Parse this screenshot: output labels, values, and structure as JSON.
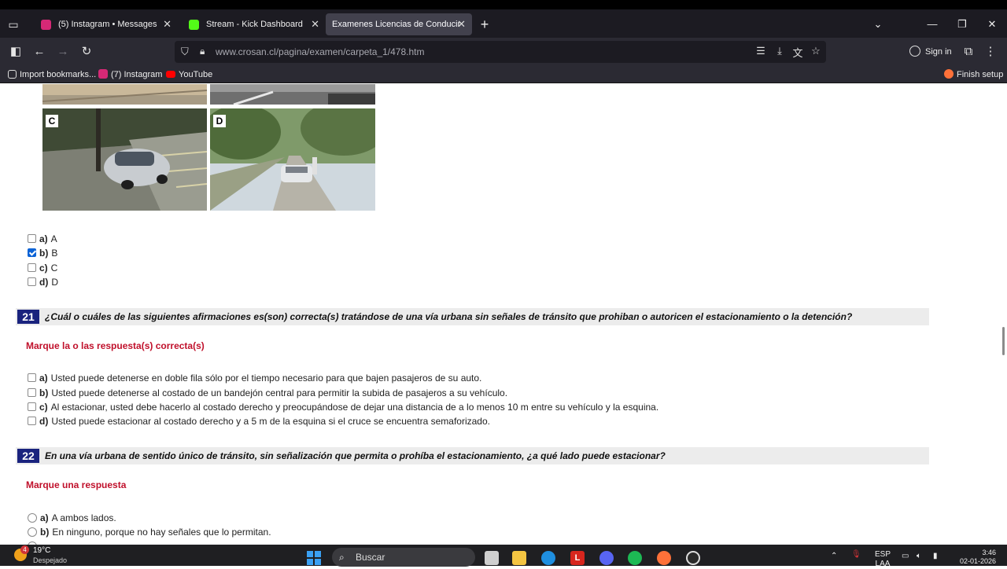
{
  "browser": {
    "tabs": [
      {
        "title": "(5) Instagram • Messages",
        "active": false,
        "favicon_color": "#d62976"
      },
      {
        "title": "Stream - Kick Dashboard",
        "active": false,
        "favicon_color": "#53fc18"
      },
      {
        "title": "Examenes Licencias de Conducir",
        "active": true
      }
    ],
    "url": "www.crosan.cl/pagina/examen/carpeta_1/478.htm",
    "sign_in_label": "Sign in",
    "bookmarks": [
      {
        "label": "Import bookmarks...",
        "icon": "import-icon"
      },
      {
        "label": "(7) Instagram",
        "icon": "instagram-icon"
      },
      {
        "label": "YouTube",
        "icon": "youtube-icon"
      }
    ],
    "finish_setup_label": "Finish setup"
  },
  "exam": {
    "images": [
      {
        "label": "C",
        "icon": "parked-car-photo"
      },
      {
        "label": "D",
        "icon": "street-car-photo"
      }
    ],
    "q20_options": [
      {
        "letter": "a)",
        "text": "A",
        "checked": false
      },
      {
        "letter": "b)",
        "text": "B",
        "checked": true
      },
      {
        "letter": "c)",
        "text": "C",
        "checked": false
      },
      {
        "letter": "d)",
        "text": "D",
        "checked": false
      }
    ],
    "q21": {
      "number": "21",
      "text": "¿Cuál o cuáles de las siguientes afirmaciones es(son) correcta(s) tratándose de una vía urbana sin señales de tránsito que prohiban o autoricen el estacionamiento o la detención?",
      "instruction": "Marque la o las respuesta(s) correcta(s)",
      "options": [
        {
          "letter": "a)",
          "text": "Usted puede detenerse en doble fila sólo por el tiempo necesario para que bajen pasajeros de su auto."
        },
        {
          "letter": "b)",
          "text": "Usted puede detenerse al costado de un bandejón central para permitir la subida de pasajeros a su vehículo."
        },
        {
          "letter": "c)",
          "text": "Al estacionar, usted debe hacerlo al costado derecho y preocupándose de dejar una distancia de a lo menos 10 m entre su vehículo y la esquina."
        },
        {
          "letter": "d)",
          "text": "Usted puede estacionar al costado derecho y a 5 m de la esquina si el cruce se encuentra semaforizado."
        }
      ]
    },
    "q22": {
      "number": "22",
      "text": "En una vía urbana de sentido único de tránsito, sin señalización que permita o prohíba el estacionamiento, ¿a qué lado puede estacionar?",
      "instruction": "Marque una respuesta",
      "options": [
        {
          "letter": "a)",
          "text": "A ambos lados."
        },
        {
          "letter": "b)",
          "text": "En ninguno, porque no hay señales que lo permitan."
        }
      ]
    }
  },
  "taskbar": {
    "weather_temp": "19°C",
    "weather_desc": "Despejado",
    "weather_badge": "4",
    "search_label": "Buscar",
    "lang_top": "ESP",
    "lang_bottom": "LAA",
    "time": "3:46",
    "date": "02-01-2026"
  }
}
